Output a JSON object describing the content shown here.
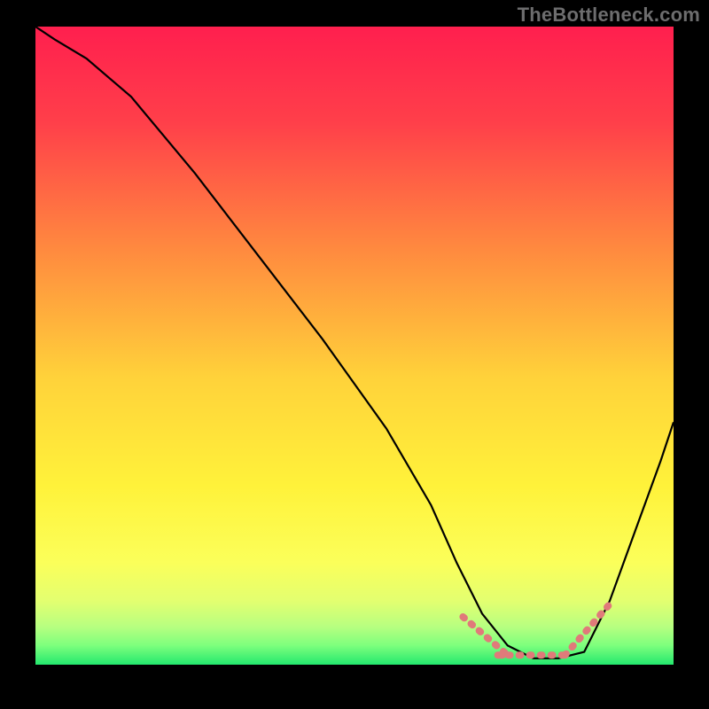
{
  "watermark": "TheBottleneck.com",
  "colors": {
    "curve": "#000000",
    "accent": "#e07a7a",
    "gradient_stops": [
      {
        "offset": 0.0,
        "color": "#ff1f4e"
      },
      {
        "offset": 0.15,
        "color": "#ff3f4a"
      },
      {
        "offset": 0.35,
        "color": "#ff8a3f"
      },
      {
        "offset": 0.55,
        "color": "#ffd23a"
      },
      {
        "offset": 0.72,
        "color": "#fff23a"
      },
      {
        "offset": 0.84,
        "color": "#fbff5a"
      },
      {
        "offset": 0.9,
        "color": "#e3ff70"
      },
      {
        "offset": 0.94,
        "color": "#b8ff80"
      },
      {
        "offset": 0.97,
        "color": "#7dff7d"
      },
      {
        "offset": 1.0,
        "color": "#24e86e"
      }
    ]
  },
  "chart_data": {
    "type": "line",
    "title": "",
    "xlabel": "",
    "ylabel": "",
    "xlim": [
      0,
      100
    ],
    "ylim": [
      0,
      100
    ],
    "series": [
      {
        "name": "bottleneck_curve",
        "x": [
          0,
          3,
          8,
          15,
          25,
          35,
          45,
          55,
          62,
          66,
          70,
          74,
          78,
          82,
          86,
          90,
          94,
          98,
          100
        ],
        "values": [
          100,
          98,
          95,
          89,
          77,
          64,
          51,
          37,
          25,
          16,
          8,
          3,
          1,
          1,
          2,
          10,
          21,
          32,
          38
        ]
      }
    ],
    "flat_segment": {
      "x_start": 70,
      "x_end": 86,
      "approx_y": 1.5
    },
    "annotations": []
  },
  "style": {
    "curve_width": 2.2,
    "accent_width": 8
  }
}
